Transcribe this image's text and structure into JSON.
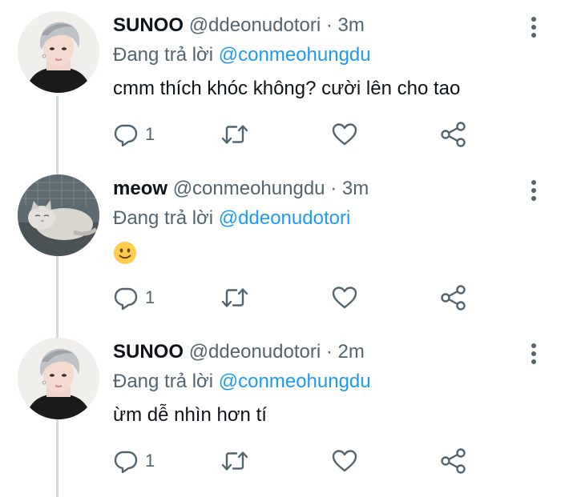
{
  "tweets": [
    {
      "name": "SUNOO",
      "handle": "@ddeonudotori",
      "separator": "·",
      "time": "3m",
      "reply_prefix": "Đang trả lời",
      "reply_to": "@conmeohungdu",
      "text": "cmm thích khóc không? cười lên cho tao",
      "reply_count": "1",
      "avatar": "sunoo-avatar",
      "actions": [
        "reply-icon",
        "retweet-icon",
        "like-icon",
        "share-icon"
      ]
    },
    {
      "name": "meow",
      "handle": "@conmeohungdu",
      "separator": "·",
      "time": "3m",
      "reply_prefix": "Đang trả lời",
      "reply_to": "@ddeonudotori",
      "text": "",
      "emoji": "slightly-smiling-face-emoji",
      "reply_count": "1",
      "avatar": "cat-avatar",
      "actions": [
        "reply-icon",
        "retweet-icon",
        "like-icon",
        "share-icon"
      ]
    },
    {
      "name": "SUNOO",
      "handle": "@ddeonudotori",
      "separator": "·",
      "time": "2m",
      "reply_prefix": "Đang trả lời",
      "reply_to": "@conmeohungdu",
      "text": "ừm dễ nhìn hơn tí",
      "reply_count": "1",
      "avatar": "sunoo-avatar",
      "actions": [
        "reply-icon",
        "retweet-icon",
        "like-icon",
        "share-icon"
      ]
    }
  ],
  "colors": {
    "text": "#0f1419",
    "secondary": "#536471",
    "link": "#1d9bf0",
    "thread_line": "#cfd9de",
    "emoji": "#ffcc4d"
  }
}
